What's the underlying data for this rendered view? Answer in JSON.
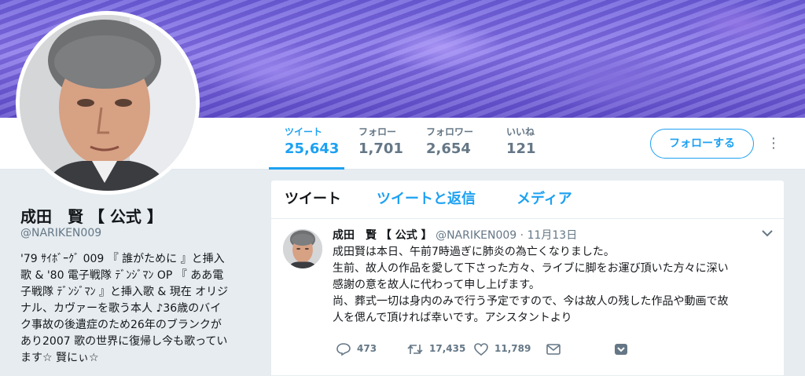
{
  "profile": {
    "name": "成田　賢 【 公式 】",
    "handle": "@NARIKEN009",
    "bio_lines": [
      "'79 ｻｲﾎﾞｰｸﾞ 009 『 誰がために 』と挿入",
      "歌 & '80 電子戦隊 ﾃﾞﾝｼﾞﾏﾝ OP 『 ああ電",
      "子戦隊 ﾃﾞﾝｼﾞﾏﾝ 』と挿入歌 & 現在 オリジ",
      "ナル、カヴァーを歌う本人 ♪36歳のバイ",
      "ク事故の後遺症のため26年のブランクが",
      "あり2007 歌の世界に復帰し今も歌ってい",
      "ます☆ 賢にぃ☆"
    ]
  },
  "stats": {
    "tweets": {
      "label": "ツイート",
      "value": "25,643"
    },
    "following": {
      "label": "フォロー",
      "value": "1,701"
    },
    "followers": {
      "label": "フォロワー",
      "value": "2,654"
    },
    "likes": {
      "label": "いいね",
      "value": "121"
    }
  },
  "follow_button": "フォローする",
  "more_icon": "⋮",
  "timeline": {
    "tabs": [
      "ツイート",
      "ツイートと返信",
      "メディア"
    ],
    "tweet": {
      "name": "成田　賢 【 公式 】",
      "handle": "@NARIKEN009",
      "separator": "·",
      "time": "11月13日",
      "caret": "⌄",
      "text_lines": [
        "成田賢は本日、午前7時過ぎに肺炎の為亡くなりました。",
        "生前、故人の作品を愛して下さった方々、ライブに脚をお運び頂いた方々に深い",
        "感謝の意を故人に代わって申し上げます。",
        "尚、葬式一切は身内のみで行う予定ですので、今は故人の残した作品や動画で故",
        "人を偲んで頂ければ幸いです。アシスタントより"
      ],
      "reply_count": "473",
      "retweet_count": "17,435",
      "like_count": "11,789"
    }
  },
  "colors": {
    "accent": "#1da1f2",
    "muted": "#657786",
    "background": "#e6ecf0"
  }
}
